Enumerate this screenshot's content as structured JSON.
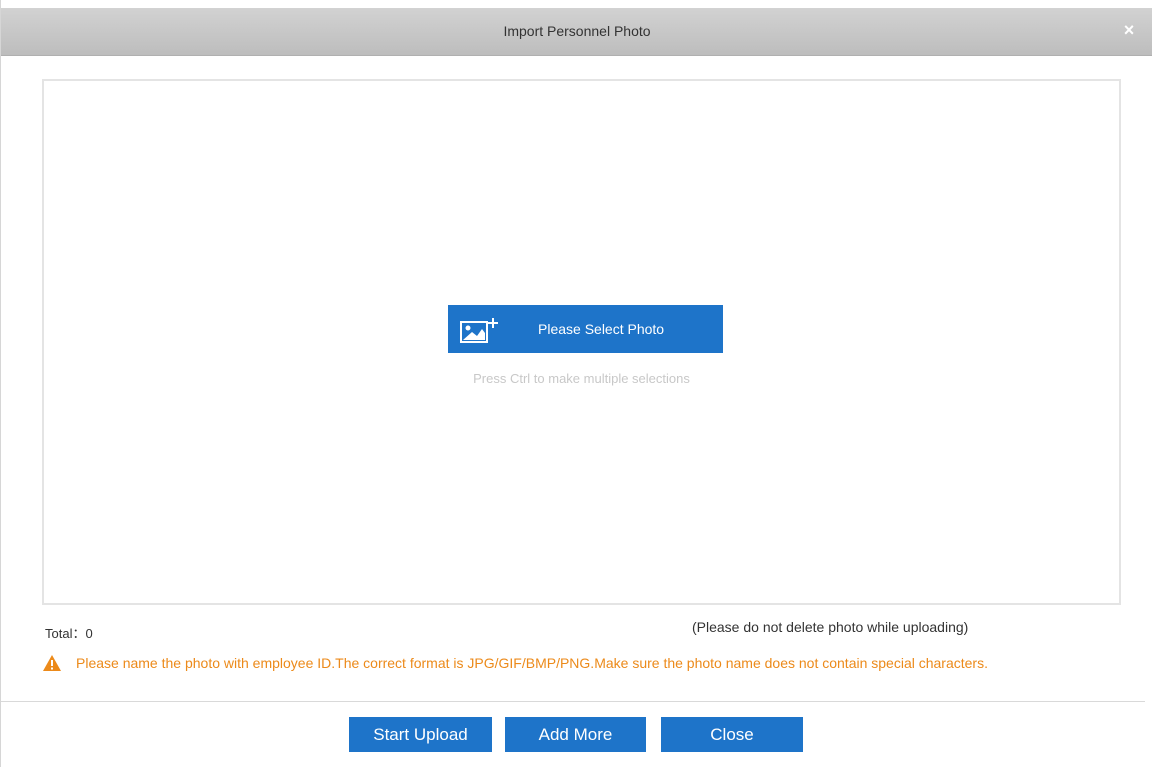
{
  "dialog": {
    "title": "Import Personnel Photo",
    "close_glyph": "×"
  },
  "dropzone": {
    "select_button_label": "Please Select Photo",
    "select_icon": "add-image-icon",
    "hint": "Press Ctrl to make multiple selections"
  },
  "status": {
    "total_label": "Total：",
    "total_value": "0",
    "no_delete_note": "(Please do not delete photo while uploading)"
  },
  "warning": {
    "icon": "warning-triangle-icon",
    "text": "Please name the photo with employee ID.The correct format is JPG/GIF/BMP/PNG.Make sure the photo name does not contain special characters."
  },
  "footer": {
    "start_upload": "Start Upload",
    "add_more": "Add More",
    "close": "Close"
  },
  "colors": {
    "accent": "#1e74c9",
    "warning": "#ec8a1a",
    "titlebar": "#c8c8c8"
  }
}
